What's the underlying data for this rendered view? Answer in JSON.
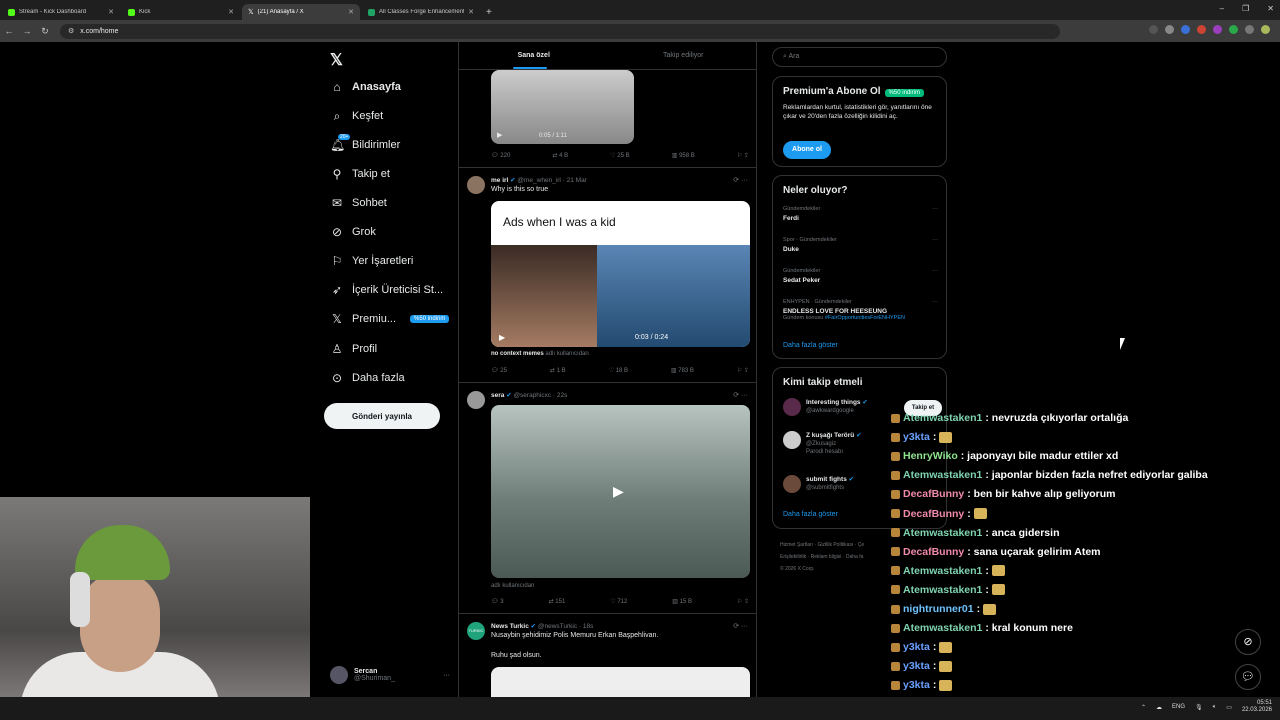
{
  "browser": {
    "tabs": [
      {
        "label": "Stream - Kick Dashboard"
      },
      {
        "label": "Kick"
      },
      {
        "label": "(21) Anasayfa / X"
      },
      {
        "label": "All Classes Forge Enhancement"
      }
    ],
    "url": "x.com/home"
  },
  "nav": {
    "items": [
      {
        "label": "Anasayfa"
      },
      {
        "label": "Keşfet"
      },
      {
        "label": "Bildirimler"
      },
      {
        "label": "Takip et"
      },
      {
        "label": "Sohbet"
      },
      {
        "label": "Grok"
      },
      {
        "label": "Yer İşaretleri"
      },
      {
        "label": "İçerik Üreticisi St..."
      },
      {
        "label": "Premiu..."
      },
      {
        "label": "Profil"
      },
      {
        "label": "Daha fazla"
      }
    ],
    "notif_count": "20+",
    "premium_badge": "%50 indirim",
    "post_button": "Gönderi yayınla",
    "account_name": "Sercan",
    "account_handle": "@Shuriman_"
  },
  "feed": {
    "tabs": [
      "Sana özel",
      "Takip ediliyor"
    ],
    "post0": {
      "time": "0:05 / 1:11",
      "replies": "220",
      "reposts": "4 B",
      "likes": "25 B",
      "views": "958 B"
    },
    "post1": {
      "name": "me irl",
      "handle": "@me_when_irl · 21 Mar",
      "text": "Why is this so true",
      "caption": "Ads when I was a kid",
      "time": "0:03 / 0:24",
      "footer_account": "no context memes",
      "footer_users": "adlı kullanıcıdan",
      "replies": "25",
      "reposts": "1 B",
      "likes": "18 B",
      "views": "783 B"
    },
    "post2": {
      "name": "sera",
      "handle": "@seraphicxc · 22s",
      "footer_users": "adlı kullanıcıdan",
      "replies": "3",
      "reposts": "151",
      "likes": "712",
      "views": "15 B"
    },
    "post3": {
      "name": "News Turkic",
      "handle": "@newsTurkic · 18s",
      "text": "Nusaybin şehidimiz Polis Memuru Erkan Başpehlivan.",
      "text2": "Ruhu şad olsun.",
      "logo": "TURKIC"
    }
  },
  "right": {
    "search_placeholder": "Ara",
    "premium": {
      "title": "Premium'a Abone Ol",
      "badge": "%50 indirim",
      "body": "Reklamlardan kurtul, istatistikleri gör, yanıtlarını öne çıkar ve 20'den fazla özelliğin kilidini aç.",
      "button": "Abone ol"
    },
    "trends": {
      "title": "Neler oluyor?",
      "items": [
        {
          "cat": "Gündemdekiler",
          "name": "Ferdi"
        },
        {
          "cat": "Spor · Gündemdekiler",
          "name": "Duke"
        },
        {
          "cat": "Gündemdekiler",
          "name": "Sedat Peker"
        },
        {
          "cat": "ENHYPEN · Gündemdekiler",
          "name": "ENDLESS LOVE FOR HEESEUNG",
          "sub": "Gündem konusu",
          "hashtag": "#FairOpportunitiesForENHYPEN"
        }
      ],
      "more": "Daha fazla göster"
    },
    "who": {
      "title": "Kimi takip etmeli",
      "items": [
        {
          "name": "Interesting things",
          "handle": "@awkwardgoogle",
          "button": "Takip et"
        },
        {
          "name": "Z kuşağı Terörü",
          "handle": "@Zkusagiz",
          "note": "Parodi hesabı"
        },
        {
          "name": "submit fights",
          "handle": "@submitfights"
        }
      ],
      "more": "Daha fazla göster"
    },
    "footer": [
      "Hizmet Şartları",
      "Gizlilik Politikası",
      "Çe",
      "Erişilebilirlik",
      "Reklam bilgisi",
      "Daha fa",
      "© 2026 X Corp."
    ]
  },
  "chat": {
    "messages": [
      {
        "user": "Atemwastaken1",
        "text": ": nevruzda çıkıyorlar ortalığa",
        "color": "#7fd3b0"
      },
      {
        "user": "y3kta",
        "text": ":",
        "color": "#6aa0ff"
      },
      {
        "user": "HenryWiko",
        "text": ": japonyayı bile madur ettiler xd",
        "color": "#8fe58f"
      },
      {
        "user": "Atemwastaken1",
        "text": ": japonlar bizden fazla nefret ediyorlar galiba",
        "color": "#7fd3b0"
      },
      {
        "user": "DecafBunny",
        "text": ": ben bir kahve alıp geliyorum",
        "color": "#f08aa8"
      },
      {
        "user": "DecafBunny",
        "text": ":",
        "color": "#f08aa8"
      },
      {
        "user": "Atemwastaken1",
        "text": ": anca gidersin",
        "color": "#7fd3b0"
      },
      {
        "user": "DecafBunny",
        "text": ": sana uçarak gelirim Atem",
        "color": "#f08aa8"
      },
      {
        "user": "Atemwastaken1",
        "text": ":",
        "color": "#7fd3b0"
      },
      {
        "user": "Atemwastaken1",
        "text": ":",
        "color": "#7fd3b0"
      },
      {
        "user": "nightrunner01",
        "text": ":",
        "color": "#6ec3ff"
      },
      {
        "user": "Atemwastaken1",
        "text": ": kral konum nere",
        "color": "#7fd3b0"
      },
      {
        "user": "y3kta",
        "text": ":",
        "color": "#6aa0ff"
      },
      {
        "user": "y3kta",
        "text": ":",
        "color": "#6aa0ff"
      },
      {
        "user": "y3kta",
        "text": ":",
        "color": "#6aa0ff"
      }
    ]
  },
  "taskbar": {
    "lang": "ENG",
    "time": "05:51",
    "date": "22.03.2026"
  }
}
